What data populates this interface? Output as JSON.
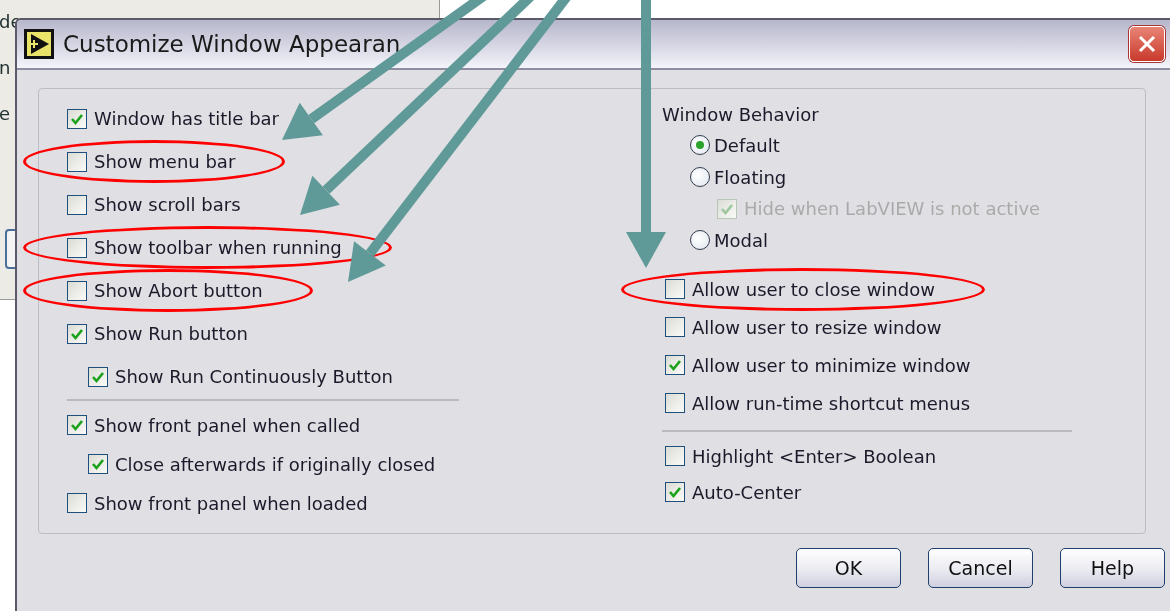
{
  "background_window": {
    "texts": [
      "de",
      "n",
      "e"
    ]
  },
  "dialog": {
    "title": "Customize Window Appearan"
  },
  "left_groups": [
    [
      {
        "label": "Window has title bar",
        "checked": true,
        "circled": false
      },
      {
        "label": "Show menu bar",
        "checked": false,
        "circled": true
      },
      {
        "label": "Show scroll bars",
        "checked": false,
        "circled": false
      },
      {
        "label": "Show toolbar when running",
        "checked": false,
        "circled": true
      },
      {
        "label": "Show Abort button",
        "checked": false,
        "circled": true
      },
      {
        "label": "Show Run button",
        "checked": true,
        "circled": false,
        "children": [
          {
            "label": "Show Run Continuously Button",
            "checked": true,
            "circled": false
          }
        ]
      }
    ],
    [
      {
        "label": "Show front panel when called",
        "checked": true,
        "circled": false,
        "children": [
          {
            "label": "Close afterwards if originally closed",
            "checked": true,
            "circled": false
          }
        ]
      },
      {
        "label": "Show front panel when loaded",
        "checked": false,
        "circled": false
      }
    ]
  ],
  "window_behavior": {
    "label": "Window Behavior",
    "options": [
      {
        "label": "Default",
        "selected": true
      },
      {
        "label": "Floating",
        "selected": false,
        "children": [
          {
            "label": "Hide when LabVIEW is not active",
            "checked": true,
            "disabled": true
          }
        ]
      },
      {
        "label": "Modal",
        "selected": false
      }
    ]
  },
  "right_groups": [
    [
      {
        "label": "Allow user to close window",
        "checked": false,
        "circled": true
      },
      {
        "label": "Allow user to resize window",
        "checked": false,
        "circled": false
      },
      {
        "label": "Allow user to minimize window",
        "checked": true,
        "circled": false
      },
      {
        "label": "Allow run-time shortcut menus",
        "checked": false,
        "circled": false
      }
    ],
    [
      {
        "label": "Highlight <Enter> Boolean",
        "checked": false,
        "circled": false
      },
      {
        "label": "Auto-Center",
        "checked": true,
        "circled": false
      }
    ]
  ],
  "buttons": [
    "OK",
    "Cancel",
    "Help"
  ]
}
